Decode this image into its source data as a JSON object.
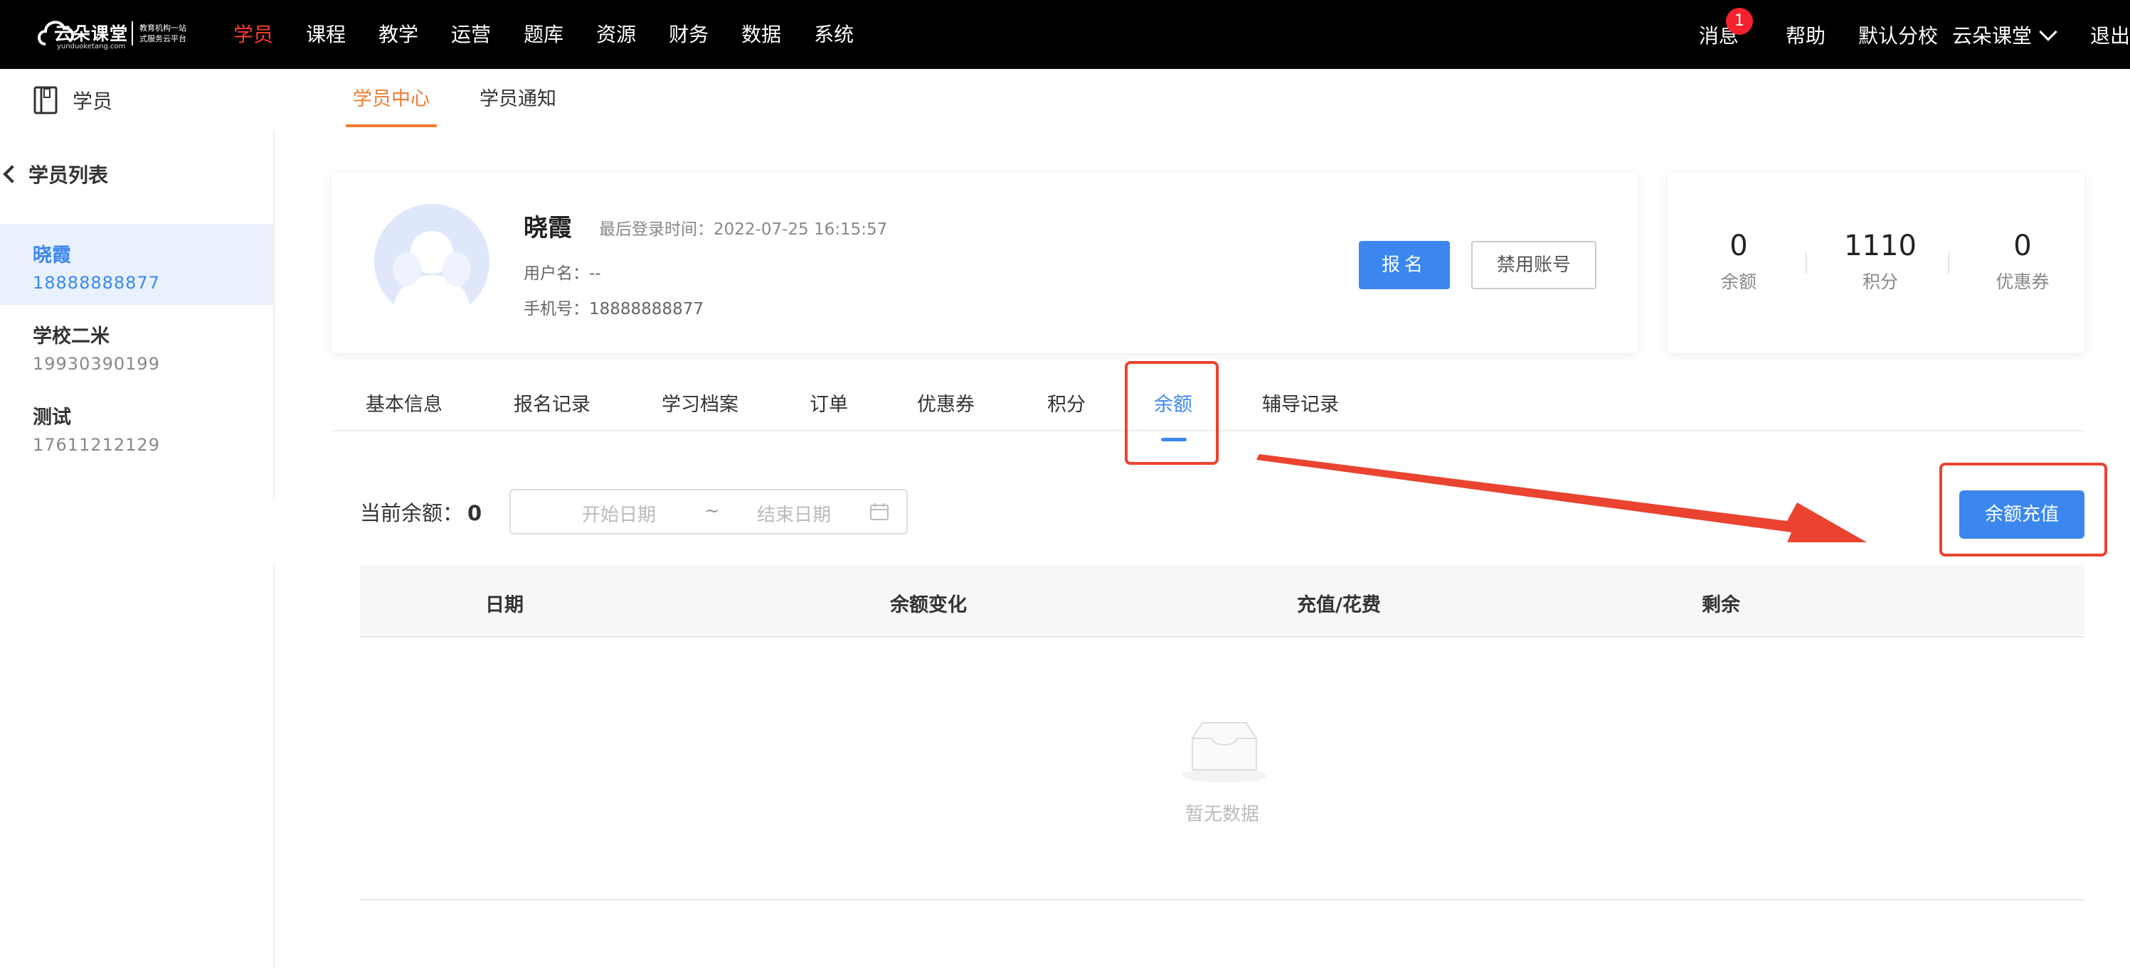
{
  "brand": {
    "name": "云朵课堂",
    "domain": "yunduoketang.com",
    "slogan_line1": "教育机构一站",
    "slogan_line2": "式服务云平台"
  },
  "topnav": {
    "items": [
      "学员",
      "课程",
      "教学",
      "运营",
      "题库",
      "资源",
      "财务",
      "数据",
      "系统"
    ],
    "active": "学员",
    "right": {
      "messages": "消息",
      "message_badge": "1",
      "help": "帮助",
      "campus": "默认分校",
      "org": "云朵课堂",
      "logout": "退出"
    }
  },
  "subheader": {
    "module": "学员",
    "tabs": [
      "学员中心",
      "学员通知"
    ],
    "active_tab": "学员中心"
  },
  "sidebar": {
    "back_label": "学员列表",
    "students": [
      {
        "name": "晓霞",
        "phone": "18888888877",
        "active": true
      },
      {
        "name": "学校二米",
        "phone": "19930390199",
        "active": false
      },
      {
        "name": "测试",
        "phone": "17611212129",
        "active": false
      }
    ],
    "collapse_icon": "«"
  },
  "profile": {
    "name": "晓霞",
    "last_login_label": "最后登录时间：",
    "last_login": "2022-07-25 16:15:57",
    "username_label": "用户名：",
    "username": "--",
    "phone_label": "手机号：",
    "phone": "18888888877",
    "enroll_button": "报名",
    "disable_button": "禁用账号"
  },
  "stats": [
    {
      "value": "0",
      "label": "余额"
    },
    {
      "value": "1110",
      "label": "积分"
    },
    {
      "value": "0",
      "label": "优惠券"
    }
  ],
  "detail_tabs": [
    "基本信息",
    "报名记录",
    "学习档案",
    "订单",
    "优惠券",
    "积分",
    "余额",
    "辅导记录"
  ],
  "active_detail_tab": "余额",
  "balance": {
    "label": "当前余额：",
    "value": "0",
    "start_placeholder": "开始日期",
    "separator": "~",
    "end_placeholder": "结束日期",
    "recharge_button": "余额充值"
  },
  "table": {
    "columns": [
      "日期",
      "余额变化",
      "充值/花费",
      "剩余"
    ],
    "empty_text": "暂无数据"
  },
  "colors": {
    "accent": "#3b87ef",
    "active_nav": "#ff3b30",
    "subtab_active": "#f07b2f",
    "annotation": "#ea4330"
  }
}
